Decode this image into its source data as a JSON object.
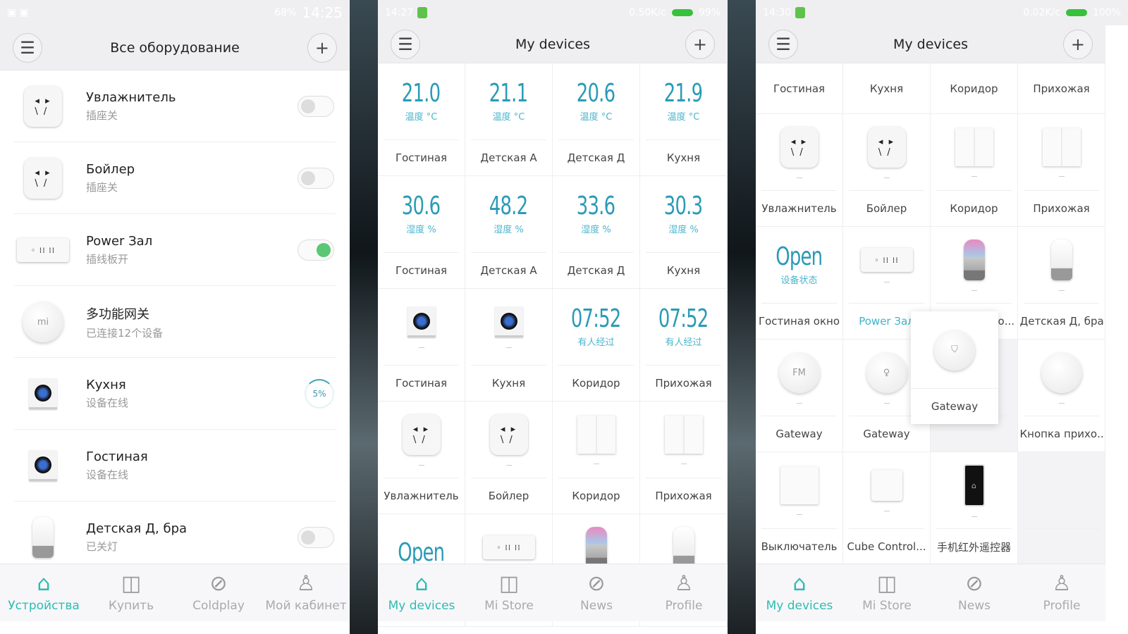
{
  "colors": {
    "accent": "#2bbdb2",
    "value": "#2a9bb6",
    "toggle_on": "#5ac774"
  },
  "panel1": {
    "status": {
      "battery": "68%",
      "time": "14:25"
    },
    "title": "Все оборудование",
    "menu_icon": "hamburger-icon",
    "add_icon": "plus-icon",
    "items": [
      {
        "name": "Увлажнитель",
        "sub": "插座关",
        "icon": "socket",
        "control": "toggle",
        "on": false
      },
      {
        "name": "Бойлер",
        "sub": "插座关",
        "icon": "socket",
        "control": "toggle",
        "on": false
      },
      {
        "name": "Power Зал",
        "sub": "插线板开",
        "icon": "strip",
        "control": "toggle",
        "on": true
      },
      {
        "name": "多功能网关",
        "sub": "已连接12个设备",
        "icon": "gateway",
        "control": "none"
      },
      {
        "name": "Кухня",
        "sub": "设备在线",
        "icon": "camera",
        "control": "progress",
        "progress": "5%"
      },
      {
        "name": "Гостиная",
        "sub": "设备在线",
        "icon": "camera",
        "control": "none"
      },
      {
        "name": "Детская Д, бра",
        "sub": "已关灯",
        "icon": "bulb",
        "control": "toggle",
        "on": false
      }
    ],
    "nav": [
      {
        "label": "Устройства",
        "icon": "home",
        "active": true
      },
      {
        "label": "Купить",
        "icon": "store"
      },
      {
        "label": "Coldplay",
        "icon": "compass"
      },
      {
        "label": "Мой кабинет",
        "icon": "person"
      }
    ]
  },
  "panel2": {
    "status": {
      "time": "14:27",
      "speed": "0.50K/c",
      "battery": "99%"
    },
    "title": "My devices",
    "cells": [
      {
        "type": "value",
        "value": "21.0",
        "unit": "温度 °C",
        "label": "Гостиная"
      },
      {
        "type": "value",
        "value": "21.1",
        "unit": "温度 °C",
        "label": "Детская А"
      },
      {
        "type": "value",
        "value": "20.6",
        "unit": "温度 °C",
        "label": "Детская Д"
      },
      {
        "type": "value",
        "value": "21.9",
        "unit": "温度 °C",
        "label": "Кухня"
      },
      {
        "type": "value",
        "value": "30.6",
        "unit": "湿度 %",
        "label": "Гостиная"
      },
      {
        "type": "value",
        "value": "48.2",
        "unit": "湿度 %",
        "label": "Детская А"
      },
      {
        "type": "value",
        "value": "33.6",
        "unit": "湿度 %",
        "label": "Детская Д"
      },
      {
        "type": "value",
        "value": "30.3",
        "unit": "湿度 %",
        "label": "Кухня"
      },
      {
        "type": "icon",
        "icon": "camera",
        "label": "Гостиная"
      },
      {
        "type": "icon",
        "icon": "camera",
        "label": "Кухня"
      },
      {
        "type": "value",
        "value": "07:52",
        "unit": "有人经过",
        "label": "Коридор"
      },
      {
        "type": "value",
        "value": "07:52",
        "unit": "有人经过",
        "label": "Прихожая"
      },
      {
        "type": "icon",
        "icon": "socket",
        "label": "Увлажнитель"
      },
      {
        "type": "icon",
        "icon": "socket",
        "label": "Бойлер"
      },
      {
        "type": "icon",
        "icon": "switch",
        "label": "Коридор"
      },
      {
        "type": "icon",
        "icon": "switch",
        "label": "Прихожая"
      },
      {
        "type": "value",
        "value": "Open",
        "unit": "",
        "label": ""
      },
      {
        "type": "icon",
        "icon": "strip",
        "label": ""
      },
      {
        "type": "icon",
        "icon": "colorbulb",
        "label": ""
      },
      {
        "type": "icon",
        "icon": "bulb",
        "label": ""
      }
    ],
    "nav": [
      {
        "label": "My devices",
        "icon": "home",
        "active": true
      },
      {
        "label": "Mi Store",
        "icon": "store"
      },
      {
        "label": "News",
        "icon": "compass"
      },
      {
        "label": "Profile",
        "icon": "person"
      }
    ]
  },
  "panel3": {
    "status": {
      "time": "14:30",
      "speed": "0.02K/c",
      "battery": "100%"
    },
    "title": "My devices",
    "top_labels": [
      "Гостиная",
      "Кухня",
      "Коридор",
      "Прихожая"
    ],
    "cells": [
      {
        "type": "icon",
        "icon": "socket",
        "label": "Увлажнитель"
      },
      {
        "type": "icon",
        "icon": "socket",
        "label": "Бойлер"
      },
      {
        "type": "icon",
        "icon": "switch",
        "label": "Коридор"
      },
      {
        "type": "icon",
        "icon": "switch",
        "label": "Прихожая"
      },
      {
        "type": "value",
        "value": "Open",
        "unit": "设备状态",
        "label": "Гостиная окно"
      },
      {
        "type": "icon",
        "icon": "strip",
        "label": "Power Зал",
        "highlight": true
      },
      {
        "type": "icon",
        "icon": "colorbulb",
        "label": "о..."
      },
      {
        "type": "icon",
        "icon": "bulb",
        "label": "Детская Д, бра"
      },
      {
        "type": "icon",
        "icon": "gateway-fm",
        "label": "Gateway"
      },
      {
        "type": "icon",
        "icon": "gateway-light",
        "label": "Gateway"
      },
      {
        "type": "empty",
        "label": ""
      },
      {
        "type": "icon",
        "icon": "button",
        "label": "Кнопка прихо..."
      },
      {
        "type": "icon",
        "icon": "wallswitch",
        "label": "Выключатель"
      },
      {
        "type": "icon",
        "icon": "cube",
        "label": "Cube Control..."
      },
      {
        "type": "icon",
        "icon": "phone",
        "label": "手机红外遥控器"
      },
      {
        "type": "empty",
        "label": ""
      }
    ],
    "dragging": {
      "icon": "gateway-shield",
      "label": "Gateway"
    },
    "nav": [
      {
        "label": "My devices",
        "icon": "home",
        "active": true
      },
      {
        "label": "Mi Store",
        "icon": "store"
      },
      {
        "label": "News",
        "icon": "compass"
      },
      {
        "label": "Profile",
        "icon": "person"
      }
    ]
  }
}
